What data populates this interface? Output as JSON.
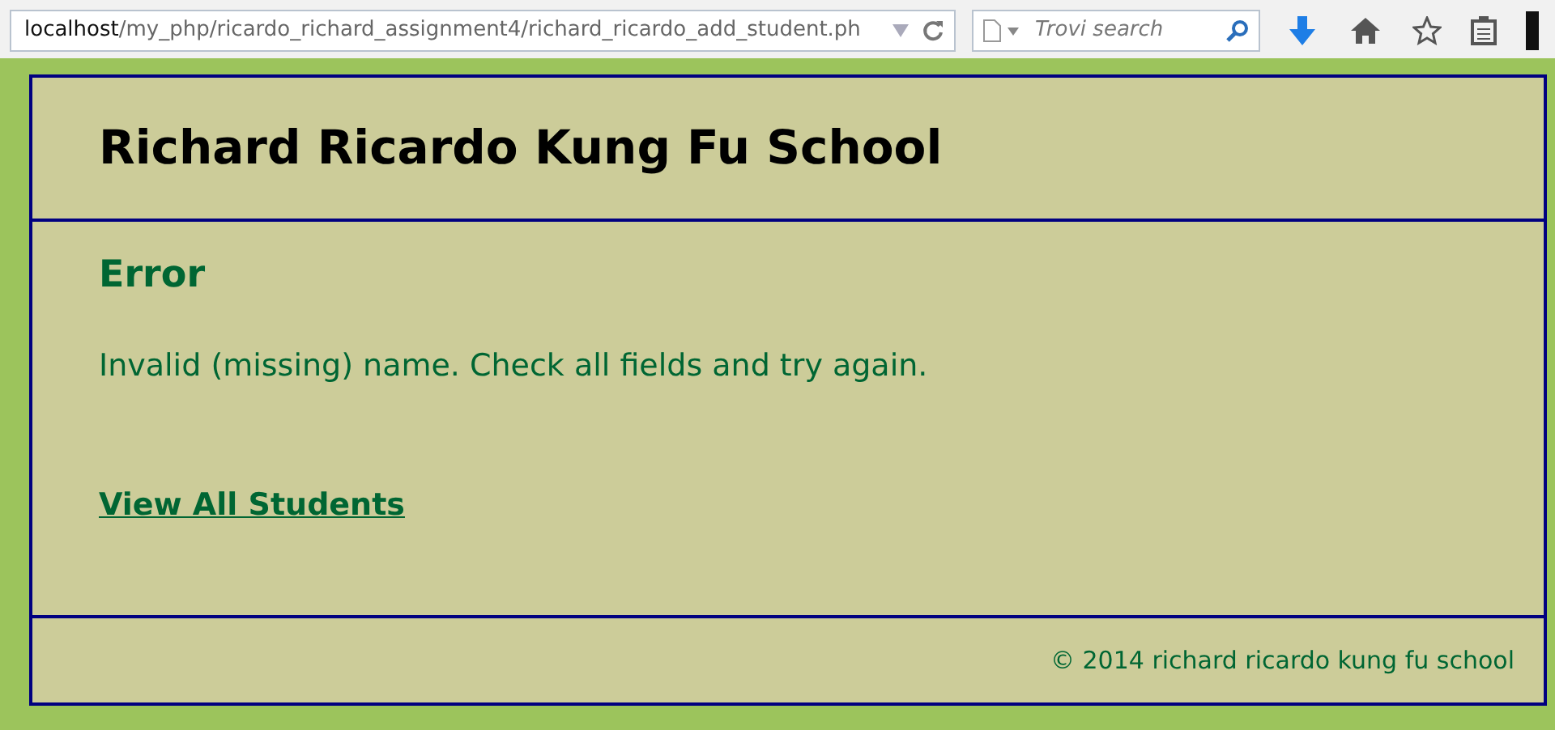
{
  "browser": {
    "url_host": "localhost",
    "url_path": "/my_php/ricardo_richard_assignment4/richard_ricardo_add_student.ph",
    "search_placeholder": "Trovi search"
  },
  "header": {
    "title": "Richard Ricardo Kung Fu School"
  },
  "main": {
    "heading": "Error",
    "message": "Invalid (missing) name. Check all fields and try again.",
    "link": "View All Students"
  },
  "footer": {
    "text": "© 2014 richard ricardo kung fu school"
  }
}
